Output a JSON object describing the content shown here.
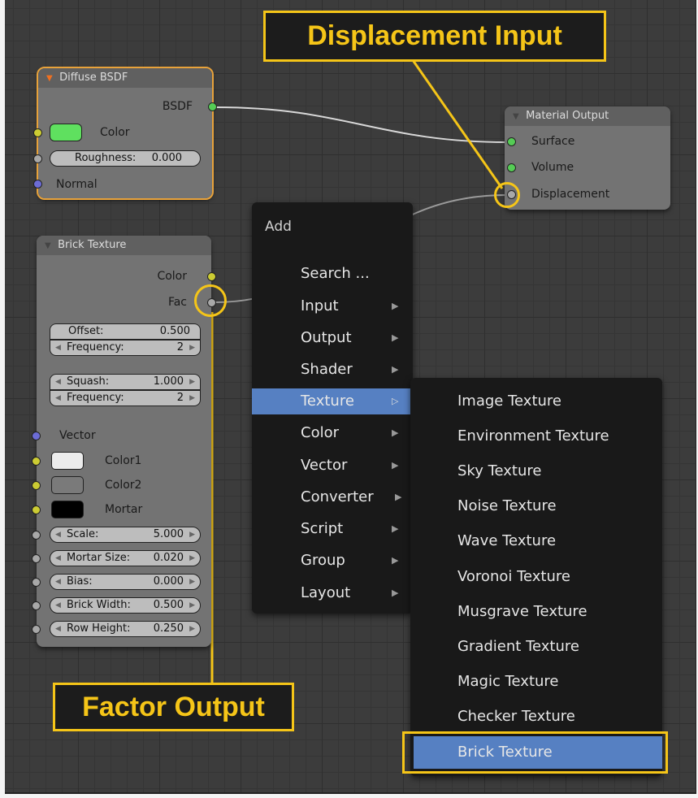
{
  "diffuse_node": {
    "title": "Diffuse BSDF",
    "output": "BSDF",
    "color_label": "Color",
    "color_value": "#5fe05f",
    "roughness_label": "Roughness:",
    "roughness_value": "0.000",
    "normal_label": "Normal"
  },
  "material_output": {
    "title": "Material Output",
    "surface": "Surface",
    "volume": "Volume",
    "displacement": "Displacement"
  },
  "brick_node": {
    "title": "Brick Texture",
    "out_color": "Color",
    "out_fac": "Fac",
    "offset_label": "Offset:",
    "offset_value": "0.500",
    "frequency1_label": "Frequency:",
    "frequency1_value": "2",
    "squash_label": "Squash:",
    "squash_value": "1.000",
    "frequency2_label": "Frequency:",
    "frequency2_value": "2",
    "vector_label": "Vector",
    "color1_label": "Color1",
    "color1_value": "#ececec",
    "color2_label": "Color2",
    "color2_value": "#7a7a7a",
    "mortar_label": "Mortar",
    "mortar_value": "#000000",
    "scale_label": "Scale:",
    "scale_value": "5.000",
    "mortar_size_label": "Mortar Size:",
    "mortar_size_value": "0.020",
    "bias_label": "Bias:",
    "bias_value": "0.000",
    "brick_width_label": "Brick Width:",
    "brick_width_value": "0.500",
    "row_height_label": "Row Height:",
    "row_height_value": "0.250"
  },
  "add_menu": {
    "title": "Add",
    "items": [
      "Search ...",
      "Input",
      "Output",
      "Shader",
      "Texture",
      "Color",
      "Vector",
      "Converter",
      "Script",
      "Group",
      "Layout"
    ],
    "highlighted": "Texture"
  },
  "texture_submenu": {
    "items": [
      "Image Texture",
      "Environment Texture",
      "Sky Texture",
      "Noise Texture",
      "Wave Texture",
      "Voronoi Texture",
      "Musgrave Texture",
      "Gradient Texture",
      "Magic Texture",
      "Checker Texture",
      "Brick Texture"
    ],
    "highlighted": "Brick Texture"
  },
  "annotations": {
    "displacement_callout": "Displacement Input",
    "factor_callout": "Factor Output",
    "accent": "#f5c518"
  }
}
